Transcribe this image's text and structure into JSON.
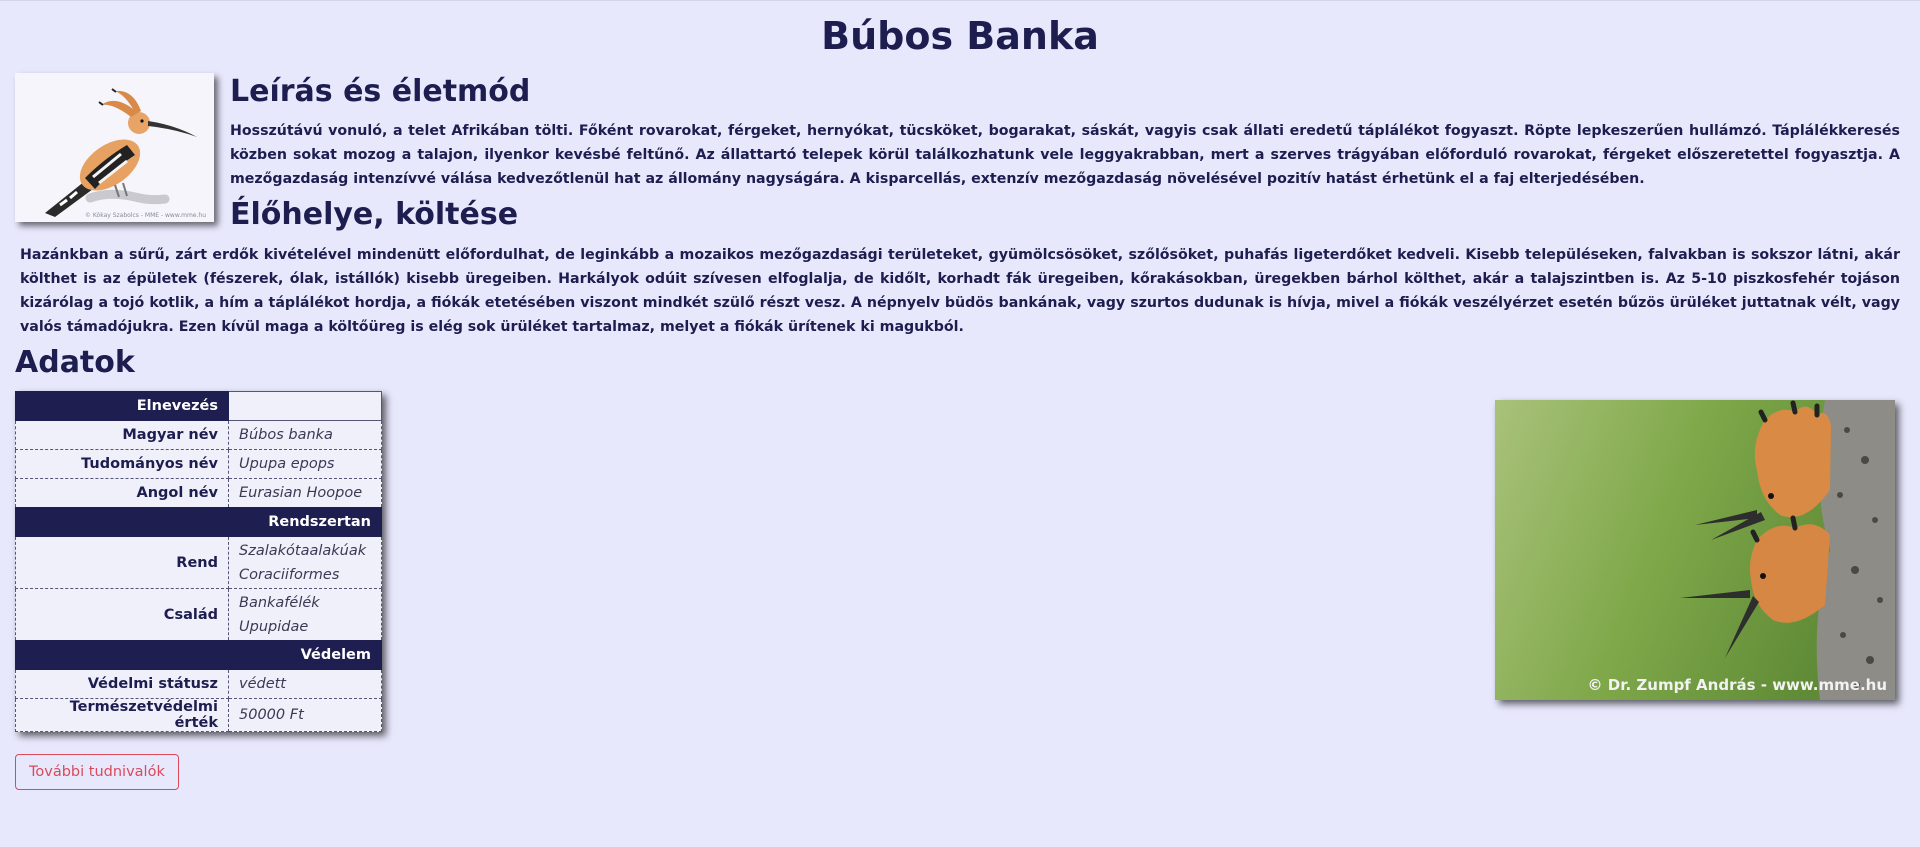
{
  "page": {
    "title": "Búbos Banka"
  },
  "description": {
    "heading": "Leírás és életmód",
    "text": "Hosszútávú vonuló, a telet Afrikában tölti. Főként rovarokat, férgeket, hernyókat, tücsköket, bogarakat, sáskát, vagyis csak állati eredetű táplálékot fogyaszt. Röpte lepkeszerűen hullámzó. Táplálékkeresés közben sokat mozog a talajon, ilyenkor kevésbé feltűnő. Az állattartó telepek körül találkozhatunk vele leggyakrabban, mert a szerves trágyában előforduló rovarokat, férgeket előszeretettel fogyasztja. A mezőgazdaság intenzívvé válása kedvezőtlenül hat az állomány nagyságára. A kisparcellás, extenzív mezőgazdaság növelésével pozitív hatást érhetünk el a faj elterjedésében.",
    "thumb_credit": "© Kókay Szabolcs - MME - www.mme.hu"
  },
  "habitat": {
    "heading": "Élőhelye, költése",
    "text": "Hazánkban a sűrű, zárt erdők kivételével mindenütt előfordulhat, de leginkább a mozaikos mezőgazdasági területeket, gyümölcsösöket, szőlősöket, puhafás ligeterdőket kedveli. Kisebb településeken, falvakban is sokszor látni, akár költhet is az épületek (fészerek, ólak, istállók) kisebb üregeiben. Harkályok odúit szívesen elfoglalja, de kidőlt, korhadt fák üregeiben, kőrakásokban, üregekben bárhol költhet, akár a talajszintben is. Az 5-10 piszkosfehér tojáson kizárólag a tojó kotlik, a hím a táplálékot hordja, a fiókák etetésében viszont mindkét szülő részt vesz. A népnyelv büdös bankának, vagy szurtos dudunak is hívja, mivel a fiókák veszélyérzet esetén bűzös ürüléket juttatnak vélt, vagy valós támadójukra. Ezen kívül maga a költőüreg is elég sok ürüléket tartalmaz, melyet a fiókák ürítenek ki magukból."
  },
  "data": {
    "heading": "Adatok",
    "sections": {
      "naming": "Elnevezés",
      "taxonomy": "Rendszertan",
      "protection": "Védelem"
    },
    "rows": {
      "hu_name_label": "Magyar név",
      "hu_name_value": "Búbos banka",
      "sci_name_label": "Tudományos név",
      "sci_name_value": "Upupa epops",
      "en_name_label": "Angol név",
      "en_name_value": "Eurasian Hoopoe",
      "order_label": "Rend",
      "order_value_hu": "Szalakótaalakúak",
      "order_value_sci": "Coraciiformes",
      "family_label": "Család",
      "family_value_hu": "Bankafélék",
      "family_value_sci": "Upupidae",
      "status_label": "Védelmi státusz",
      "status_value": "védett",
      "value_label": "Természetvédelmi érték",
      "value_value": "50000 Ft"
    }
  },
  "photo": {
    "credit": "© Dr. Zumpf András - www.mme.hu"
  },
  "more_button": "További tudnivalók",
  "colors": {
    "background": "#e8e8fd",
    "primary": "#1e1e50",
    "button_outline": "#d94a5a"
  }
}
